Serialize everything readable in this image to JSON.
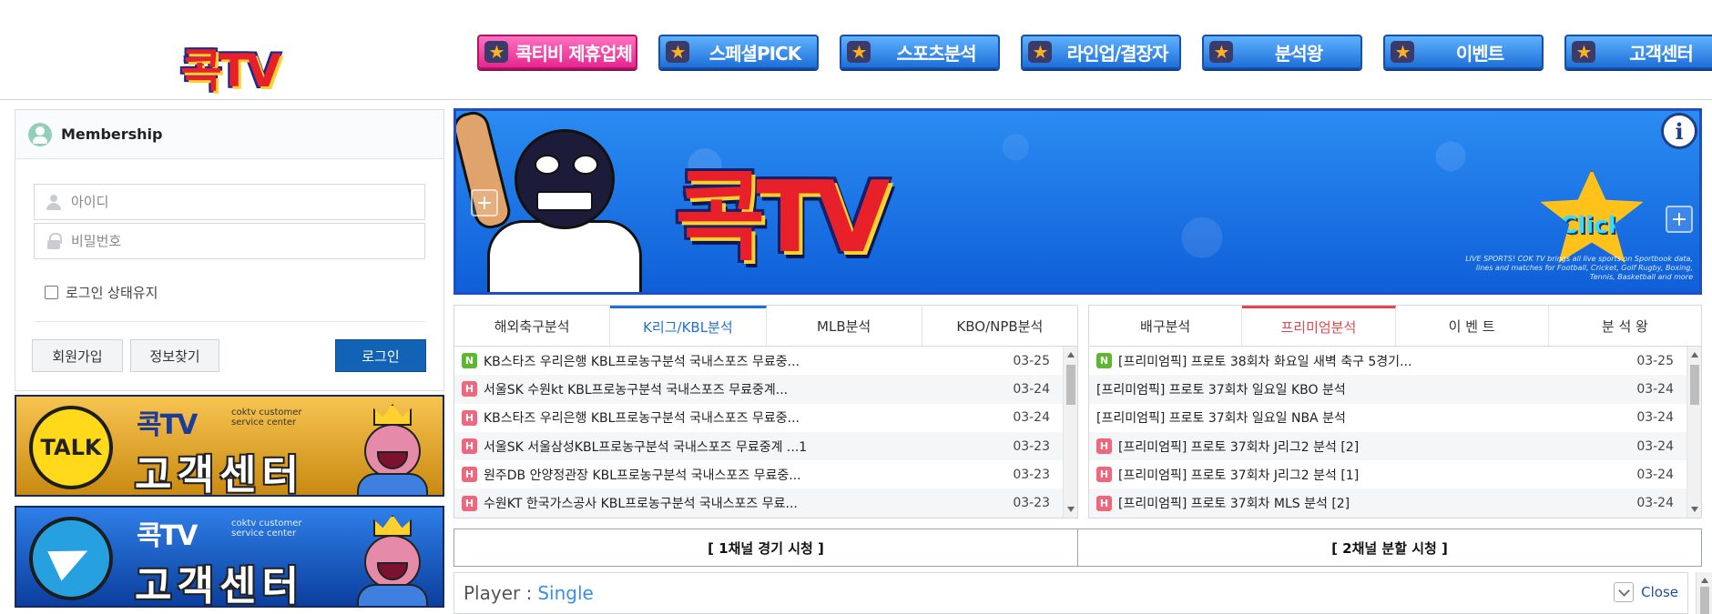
{
  "header": {
    "logo_text": "콕TV",
    "nav": [
      {
        "label": "콕티비 제휴업체",
        "style": "pink"
      },
      {
        "label": "스페셜PICK",
        "style": "blue"
      },
      {
        "label": "스포츠분석",
        "style": "blue"
      },
      {
        "label": "라인업/결장자",
        "style": "blue"
      },
      {
        "label": "분석왕",
        "style": "blue"
      },
      {
        "label": "이벤트",
        "style": "blue"
      },
      {
        "label": "고객센터",
        "style": "blue"
      }
    ]
  },
  "membership": {
    "title": "Membership",
    "id_placeholder": "아이디",
    "pw_placeholder": "비밀번호",
    "remember_label": "로그인 상태유지",
    "signup_label": "회원가입",
    "find_label": "정보찾기",
    "login_label": "로그인"
  },
  "cs_banners": {
    "kakao": {
      "circle_text": "TALK",
      "logo": "콕TV",
      "sub": "coktv customer service center",
      "main": "고객센터"
    },
    "telegram": {
      "logo": "콕TV",
      "sub": "coktv customer service center",
      "main": "고객센터"
    }
  },
  "hero": {
    "logo": "콕TV",
    "click_label": "Click",
    "info_icon": "i",
    "caption": "LIVE SPORTS! COK TV brings all live sports on Sportbook data, lines and matches for Football, Cricket, Golf Rugby, Boxing, Tennis, Basketball and more"
  },
  "left_panel": {
    "tabs": [
      "해외축구분석",
      "K리그/KBL분석",
      "MLB분석",
      "KBO/NPB분석"
    ],
    "active_tab": 1,
    "rows": [
      {
        "badge": "N",
        "title": "KB스타즈 우리은행 KBL프로농구분석 국내스포즈 무료중...",
        "date": "03-25"
      },
      {
        "badge": "H",
        "title": "서울SK 수원kt KBL프로농구분석 국내스포즈 무료중계...",
        "date": "03-24"
      },
      {
        "badge": "H",
        "title": "KB스타즈 우리은행 KBL프로농구분석 국내스포즈 무료중...",
        "date": "03-24"
      },
      {
        "badge": "H",
        "title": "서울SK 서울삼성KBL프로농구분석 국내스포즈 무료중계 ...1",
        "date": "03-23"
      },
      {
        "badge": "H",
        "title": "원주DB 안양정관장 KBL프로농구분석 국내스포즈 무료중...",
        "date": "03-23"
      },
      {
        "badge": "H",
        "title": "수원KT 한국가스공사 KBL프로농구분석 국내스포즈 무료...",
        "date": "03-23"
      }
    ]
  },
  "right_panel": {
    "tabs": [
      "배구분석",
      "프리미엄분석",
      "이 벤 트",
      "분 석 왕"
    ],
    "active_tab": 1,
    "rows": [
      {
        "badge": "N",
        "title": "[프리미엄픽] 프로토 38회차 화요일 새벽 축구 5경기...",
        "date": "03-25"
      },
      {
        "badge": "",
        "title": "[프리미엄픽] 프로토 37회차 일요일 KBO 분석",
        "date": "03-24"
      },
      {
        "badge": "",
        "title": "[프리미엄픽] 프로토 37회차 일요일 NBA 분석",
        "date": "03-24"
      },
      {
        "badge": "H",
        "title": "[프리미엄픽] 프로토 37회차 J리그2 분석 [2]",
        "date": "03-24"
      },
      {
        "badge": "H",
        "title": "[프리미엄픽] 프로토 37회차 J리그2 분석 [1]",
        "date": "03-24"
      },
      {
        "badge": "H",
        "title": "[프리미엄픽] 프로토 37회차 MLS 분석 [2]",
        "date": "03-24"
      }
    ]
  },
  "channels": {
    "single": "[ 1채널 경기 시청 ]",
    "split": "[ 2채널 분할 시청 ]"
  },
  "player": {
    "label": "Player :",
    "mode": "Single",
    "close_label": "Close"
  },
  "colors": {
    "nav_blue": "#1e6fd8",
    "nav_pink": "#e6268f",
    "login_button": "#1263b5",
    "tab_active_blue": "#1e6fd8",
    "tab_active_red": "#e8454a",
    "badge_new": "#5db82f",
    "badge_hot": "#f0667c"
  }
}
